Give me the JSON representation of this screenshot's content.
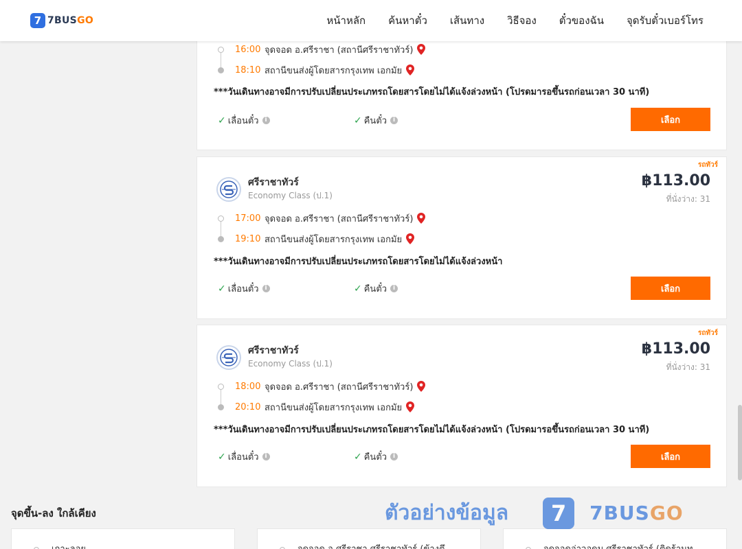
{
  "header": {
    "logo_badge": "7",
    "logo_b": "BUS",
    "logo_g": "GO",
    "nav": [
      "หน้าหลัก",
      "ค้นหาตั๋ว",
      "เส้นทาง",
      "วิธีจอง",
      "ตั๋วของฉัน",
      "จุดรับตั๋วเบอร์โทร"
    ]
  },
  "cards": [
    {
      "depart_time": "16:00",
      "depart_place": "จุดจอด อ.ศรีราชา (สถานีศรีราชาทัวร์)",
      "arrive_time": "18:10",
      "arrive_place": "สถานีขนส่งผู้โดยสารกรุงเทพ เอกมัย",
      "note": "***วันเดินทางอาจมีการปรับเปลี่ยนประเภทรถโดยสารโดยไม่ได้แจ้งล่วงหน้า (โปรดมารอขึ้นรถก่อนเวลา 30 นาที)",
      "feature1": "เลื่อนตั๋ว",
      "feature2": "คืนตั๋ว",
      "button": "เลือก"
    },
    {
      "tag": "รถทัวร์",
      "operator": "ศรีราชาทัวร์",
      "class": "Economy Class (ป.1)",
      "price": "฿113.00",
      "seats": "ที่นั่งว่าง: 31",
      "depart_time": "17:00",
      "depart_place": "จุดจอด อ.ศรีราชา (สถานีศรีราชาทัวร์)",
      "arrive_time": "19:10",
      "arrive_place": "สถานีขนส่งผู้โดยสารกรุงเทพ เอกมัย",
      "note": "***วันเดินทางอาจมีการปรับเปลี่ยนประเภทรถโดยสารโดยไม่ได้แจ้งล่วงหน้า",
      "feature1": "เลื่อนตั๋ว",
      "feature2": "คืนตั๋ว",
      "button": "เลือก"
    },
    {
      "tag": "รถทัวร์",
      "operator": "ศรีราชาทัวร์",
      "class": "Economy Class (ป.1)",
      "price": "฿113.00",
      "seats": "ที่นั่งว่าง: 31",
      "depart_time": "18:00",
      "depart_place": "จุดจอด อ.ศรีราชา (สถานีศรีราชาทัวร์)",
      "arrive_time": "20:10",
      "arrive_place": "สถานีขนส่งผู้โดยสารกรุงเทพ เอกมัย",
      "note": "***วันเดินทางอาจมีการปรับเปลี่ยนประเภทรถโดยสารโดยไม่ได้แจ้งล่วงหน้า (โปรดมารอขึ้นรถก่อนเวลา 30 นาที)",
      "feature1": "เลื่อนตั๋ว",
      "feature2": "คืนตั๋ว",
      "button": "เลือก"
    }
  ],
  "nearby": {
    "title": "จุดขึ้น-ลง ใกล้เคียง",
    "items": [
      "เกาะลอย",
      "จุดจอด อ.ศรีราชา ศรีราชาทัวร์ (ข้างตึ",
      "จุดจอดอ่าวอุดม ศรีราชาทัวร์ (ติดร้านท"
    ]
  },
  "watermark": {
    "text": "ตัวอย่างข้อมูล",
    "badge": "7",
    "brand_b": "7BUS",
    "brand_g": "GO"
  },
  "icons": {
    "pin": "map-pin-icon",
    "check": "check-icon",
    "info": "info-icon"
  },
  "colors": {
    "accent": "#ff6a00",
    "brand_blue": "#2f6fe0",
    "check_green": "#2ea44f",
    "pin_red": "#e02424"
  }
}
